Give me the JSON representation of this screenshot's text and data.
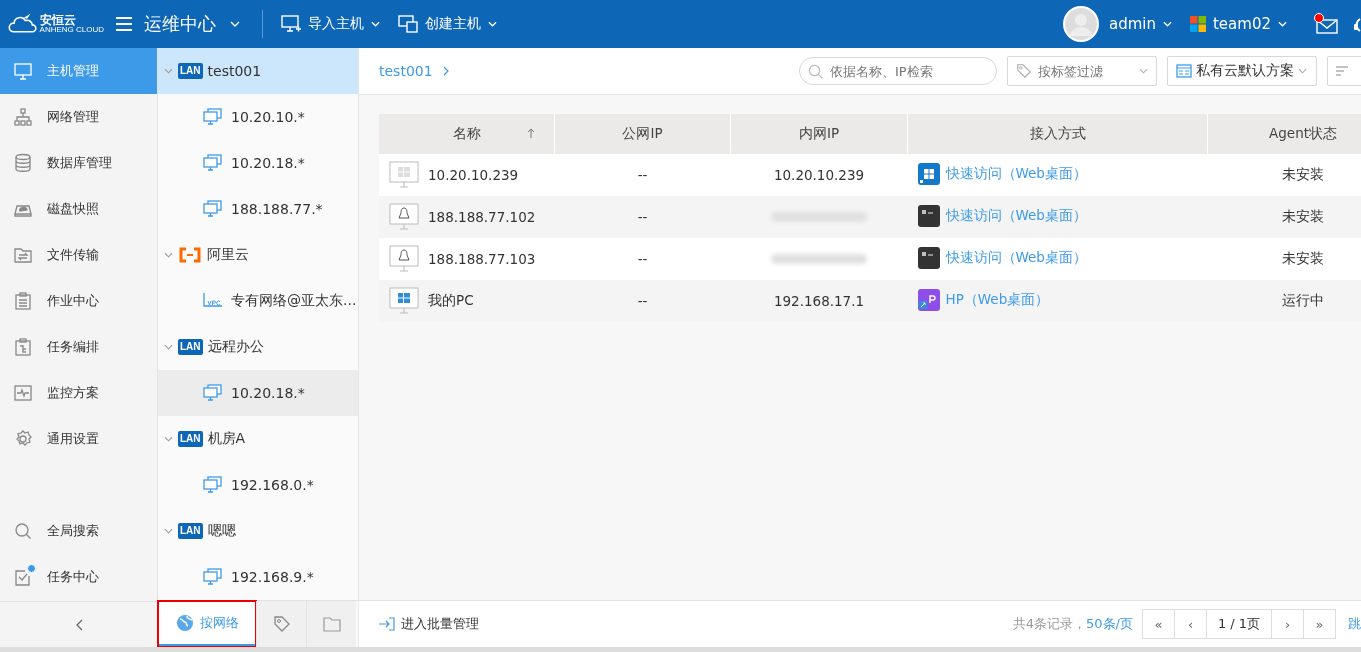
{
  "header": {
    "logo_text": "安恒云",
    "logo_subtext": "ANHENG CLOUD",
    "app_title": "运维中心",
    "menus": [
      {
        "label": "导入主机",
        "kind": "import"
      },
      {
        "label": "创建主机",
        "kind": "create"
      }
    ],
    "user": "admin",
    "team": "team02",
    "mail_unread": true
  },
  "nav": {
    "items": [
      {
        "label": "主机管理",
        "kind": "host",
        "selected": true,
        "badge": false
      },
      {
        "label": "网络管理",
        "kind": "network",
        "selected": false,
        "badge": false
      },
      {
        "label": "数据库管理",
        "kind": "database",
        "selected": false,
        "badge": false
      },
      {
        "label": "磁盘快照",
        "kind": "disk",
        "selected": false,
        "badge": false
      },
      {
        "label": "文件传输",
        "kind": "file",
        "selected": false,
        "badge": false
      },
      {
        "label": "作业中心",
        "kind": "job",
        "selected": false,
        "badge": false
      },
      {
        "label": "任务编排",
        "kind": "orchestrate",
        "selected": false,
        "badge": false
      },
      {
        "label": "监控方案",
        "kind": "monitor",
        "selected": false,
        "badge": false
      },
      {
        "label": "通用设置",
        "kind": "settings",
        "selected": false,
        "badge": false
      }
    ],
    "bottom_items": [
      {
        "label": "全局搜索",
        "kind": "search",
        "selected": false,
        "badge": false
      },
      {
        "label": "任务中心",
        "kind": "task",
        "selected": false,
        "badge": true
      }
    ]
  },
  "tree": {
    "groups": [
      {
        "label": "test001",
        "kind": "lan",
        "badge": "LAN",
        "expanded": true,
        "selected": true,
        "hovered": false,
        "children": [
          {
            "label": "10.20.10.*",
            "kind": "subnet",
            "selected": false,
            "hovered": false
          },
          {
            "label": "10.20.18.*",
            "kind": "subnet",
            "selected": false,
            "hovered": false
          },
          {
            "label": "188.188.77.*",
            "kind": "subnet",
            "selected": false,
            "hovered": false
          }
        ]
      },
      {
        "label": "阿里云",
        "kind": "aliyun",
        "expanded": true,
        "selected": false,
        "hovered": false,
        "children": [
          {
            "label": "专有网络@亚太东...",
            "kind": "vpc",
            "selected": false,
            "hovered": false
          }
        ]
      },
      {
        "label": "远程办公",
        "kind": "lan",
        "badge": "LAN",
        "expanded": true,
        "selected": false,
        "hovered": false,
        "children": [
          {
            "label": "10.20.18.*",
            "kind": "subnet",
            "selected": false,
            "hovered": true
          }
        ]
      },
      {
        "label": "机房A",
        "kind": "lan",
        "badge": "LAN",
        "expanded": true,
        "selected": false,
        "hovered": false,
        "children": [
          {
            "label": "192.168.0.*",
            "kind": "subnet",
            "selected": false,
            "hovered": false
          }
        ]
      },
      {
        "label": "嗯嗯",
        "kind": "lan",
        "badge": "LAN",
        "expanded": true,
        "selected": false,
        "hovered": false,
        "children": [
          {
            "label": "192.168.9.*",
            "kind": "subnet",
            "selected": false,
            "hovered": false
          }
        ]
      }
    ],
    "tabs": [
      {
        "label": "按网络",
        "kind": "network",
        "selected": true,
        "highlighted": true
      },
      {
        "kind": "tag",
        "selected": false,
        "highlighted": false
      },
      {
        "kind": "folder",
        "selected": false,
        "highlighted": false
      }
    ]
  },
  "toolbar": {
    "breadcrumb": "test001",
    "search": {
      "placeholder": "依据名称、IP检索"
    },
    "tag_filter": {
      "placeholder": "按标签过滤"
    },
    "scheme": "私有云默认方案"
  },
  "table": {
    "columns": [
      {
        "label": "名称",
        "sorted": true
      },
      {
        "label": "公网IP",
        "sorted": false
      },
      {
        "label": "内网IP",
        "sorted": false
      },
      {
        "label": "接入方式",
        "sorted": false
      },
      {
        "label": "Agent状态",
        "sorted": false
      }
    ],
    "rows": [
      {
        "kind": "windows",
        "name": "10.20.10.239",
        "public_ip": "--",
        "intranet_ip": "10.20.10.239",
        "access": {
          "kind": "windows",
          "label": "快速访问（Web桌面）"
        },
        "agent": "未安装"
      },
      {
        "kind": "linux",
        "name": "188.188.77.102",
        "public_ip": "--",
        "access": {
          "kind": "terminal",
          "label": "快速访问（Web桌面）"
        },
        "agent": "未安装"
      },
      {
        "kind": "linux",
        "name": "188.188.77.103",
        "public_ip": "--",
        "access": {
          "kind": "terminal",
          "label": "快速访问（Web桌面）"
        },
        "agent": "未安装"
      },
      {
        "kind": "pc",
        "name": "我的PC",
        "public_ip": "--",
        "intranet_ip": "192.168.17.1",
        "access": {
          "kind": "remote",
          "label": "HP（Web桌面）"
        },
        "agent": "运行中"
      }
    ]
  },
  "footer": {
    "batch": "进入批量管理",
    "total": "共4条记录，",
    "page_size": "50条/页",
    "pager": [
      "«",
      "‹",
      "1 / 1页",
      "›",
      "»"
    ],
    "jump": "跳"
  }
}
